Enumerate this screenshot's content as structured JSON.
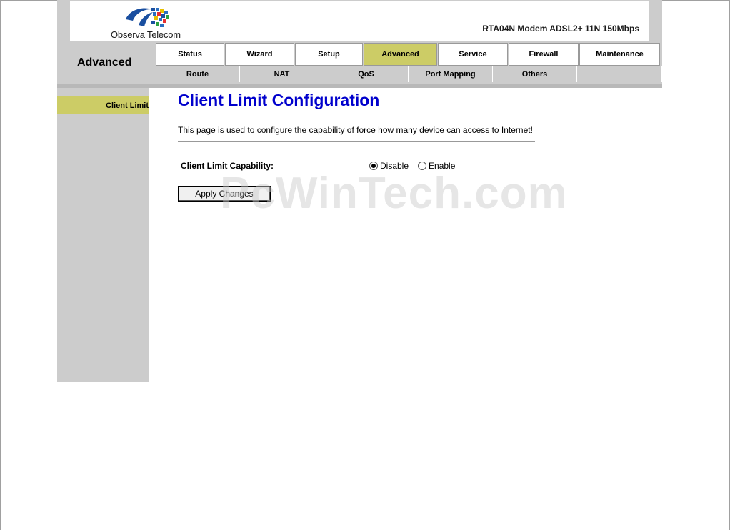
{
  "brand": {
    "logo_name": "Observa Telecom",
    "model": "RTA04N Modem ADSL2+ 11N 150Mbps"
  },
  "header": {
    "section_title": "Advanced"
  },
  "main_tabs": [
    {
      "label": "Status",
      "active": false
    },
    {
      "label": "Wizard",
      "active": false
    },
    {
      "label": "Setup",
      "active": false
    },
    {
      "label": "Advanced",
      "active": true
    },
    {
      "label": "Service",
      "active": false
    },
    {
      "label": "Firewall",
      "active": false
    },
    {
      "label": "Maintenance",
      "active": false
    }
  ],
  "sub_tabs": [
    {
      "label": "Route"
    },
    {
      "label": "NAT"
    },
    {
      "label": "QoS"
    },
    {
      "label": "Port Mapping"
    },
    {
      "label": "Others"
    },
    {
      "label": ""
    }
  ],
  "sidebar": {
    "items": [
      {
        "label": "Client Limit",
        "active": true
      }
    ]
  },
  "content": {
    "title": "Client Limit Configuration",
    "description": "This page is used to configure the capability of force how many device can access to Internet!",
    "capability_label": "Client Limit Capability:",
    "options": [
      {
        "label": "Disable",
        "checked": true
      },
      {
        "label": "Enable",
        "checked": false
      }
    ],
    "apply_button": "Apply Changes"
  },
  "watermark": "PcWinTech.com",
  "colors": {
    "accent_tab": "#cccc66",
    "header_gray": "#cccccc",
    "title_blue": "#0000cc"
  }
}
